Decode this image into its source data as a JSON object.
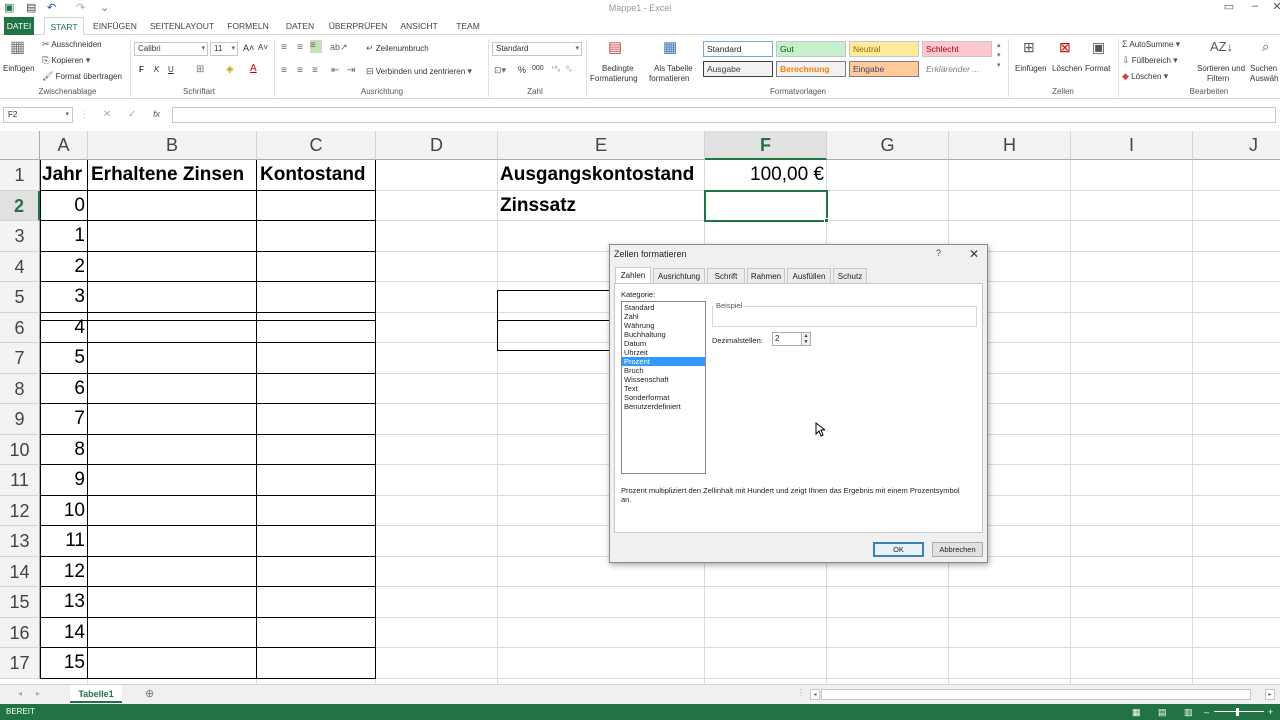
{
  "window": {
    "title": "Mappe1 - Excel"
  },
  "ribbon_tabs": [
    "DATEI",
    "START",
    "EINFÜGEN",
    "SEITENLAYOUT",
    "FORMELN",
    "DATEN",
    "ÜBERPRÜFEN",
    "ANSICHT",
    "TEAM"
  ],
  "ribbon": {
    "clipboard": {
      "paste": "Einfügen",
      "cut": "Ausschneiden",
      "copy": "Kopieren",
      "format_painter": "Format übertragen",
      "label": "Zwischenablage"
    },
    "font": {
      "font_name": "Calibri",
      "font_size": "11",
      "bold": "F",
      "italic": "K",
      "underline": "U",
      "label": "Schriftart"
    },
    "alignment": {
      "wrap": "Zeilenumbruch",
      "merge": "Verbinden und zentrieren",
      "label": "Ausrichtung"
    },
    "number": {
      "format": "Standard",
      "percent": "%",
      "thousands": "000",
      "label": "Zahl"
    },
    "styles": {
      "conditional": "Bedingte",
      "conditional2": "Formatierung",
      "as_table": "Als Tabelle",
      "as_table2": "formatieren",
      "cells": [
        "Standard",
        "Gut",
        "Neutral",
        "Schlecht",
        "Ausgabe",
        "Berechnung",
        "Eingabe",
        "Erklärender ..."
      ],
      "label": "Formatvorlagen"
    },
    "cells": {
      "insert": "Einfügen",
      "delete": "Löschen",
      "format": "Format",
      "label": "Zellen"
    },
    "editing": {
      "autosum": "AutoSumme",
      "fill": "Füllbereich",
      "clear": "Löschen",
      "sort": "Sortieren und",
      "sort2": "Filtern",
      "find": "Suchen",
      "find2": "Auswäh",
      "label": "Bearbeiten"
    }
  },
  "formula_bar": {
    "name_box": "F2",
    "fx": "fx",
    "content": ""
  },
  "grid": {
    "columns": [
      "A",
      "B",
      "C",
      "D",
      "E",
      "F",
      "G",
      "H",
      "I",
      "J"
    ],
    "rows": [
      "1",
      "2",
      "3",
      "4",
      "5",
      "6",
      "7",
      "8",
      "9",
      "10",
      "11",
      "12",
      "13",
      "14",
      "15",
      "16",
      "17"
    ],
    "selected_cell": "F2",
    "headers": {
      "jahr": "Jahr",
      "zinsen": "Erhaltene Zinsen",
      "kontostand": "Kontostand",
      "ausgang": "Ausgangskontostand",
      "ausgang_value": "100,00 €",
      "zinssatz": "Zinssatz"
    },
    "years": [
      "0",
      "1",
      "2",
      "3",
      "4",
      "5",
      "6",
      "7",
      "8",
      "9",
      "10",
      "11",
      "12",
      "13",
      "14",
      "15"
    ]
  },
  "sheet_tabs": {
    "active": "Tabelle1"
  },
  "status_bar": {
    "mode": "BEREIT"
  },
  "dialog": {
    "title": "Zellen formatieren",
    "help": "?",
    "tabs": [
      "Zahlen",
      "Ausrichtung",
      "Schrift",
      "Rahmen",
      "Ausfüllen",
      "Schutz"
    ],
    "category_label": "Kategorie:",
    "categories": [
      "Standard",
      "Zahl",
      "Währung",
      "Buchhaltung",
      "Datum",
      "Uhrzeit",
      "Prozent",
      "Bruch",
      "Wissenschaft",
      "Text",
      "Sonderformat",
      "Benutzerdefiniert"
    ],
    "selected_category": "Prozent",
    "sample_label": "Beispiel",
    "decimals_label": "Dezimalstellen:",
    "decimals_value": "2",
    "description": "Prozent multipliziert den Zellinhalt mit Hundert und zeigt Ihnen das Ergebnis mit einem Prozentsymbol an.",
    "ok": "OK",
    "cancel": "Abbrechen"
  },
  "colors": {
    "excel_green": "#217346",
    "selection_blue": "#3399ff"
  }
}
